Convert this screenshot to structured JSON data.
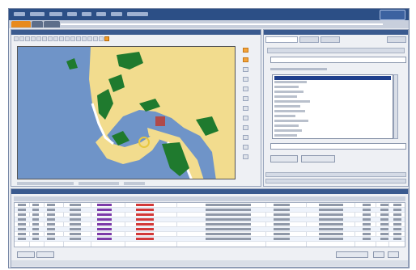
{
  "window": {
    "menu_item_count": 8,
    "tabs": [
      "active-tab",
      "tab-2",
      "tab-3"
    ]
  },
  "map": {
    "toolbar_button_count": 17,
    "active_tool_index": 16,
    "layer_toggle_count": 12
  },
  "properties": {
    "tab_count": 4,
    "list_item_count": 13,
    "selected_list_index": 0
  },
  "grid": {
    "row_count": 8,
    "column_count": 12
  },
  "colors": {
    "accent": "#e88a1c",
    "header": "#2c4f86",
    "water": "#6f94c8",
    "land": "#f2dc8e",
    "park": "#1f7a2e",
    "selection": "#1f3f8c",
    "purple_link": "#7b3aa8",
    "red_link": "#d23838"
  }
}
